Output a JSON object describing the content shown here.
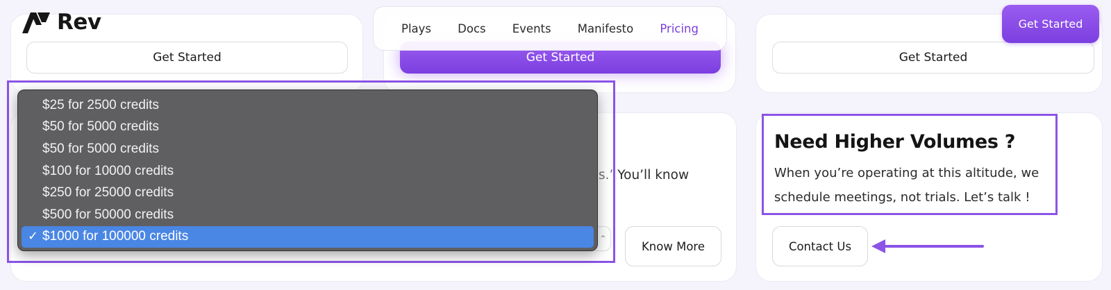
{
  "header": {
    "brand": "Rev",
    "nav": [
      {
        "label": "Plays"
      },
      {
        "label": "Docs"
      },
      {
        "label": "Events"
      },
      {
        "label": "Manifesto"
      },
      {
        "label": "Pricing"
      }
    ],
    "active_nav": "Pricing",
    "cta_label": "Get Started"
  },
  "plans": {
    "buttons": [
      "Get Started",
      "Get Started",
      "Get Started"
    ]
  },
  "credits_dropdown": {
    "options": [
      "$25 for 2500 credits",
      "$50 for 5000 credits",
      "$50 for 5000 credits",
      "$100 for 10000 credits",
      "$250 for 25000 credits",
      "$500 for 50000 credits",
      "$1000 for 100000 credits"
    ],
    "selected_index": 6,
    "check_mark": "✓"
  },
  "middle_card": {
    "partial_text": "s.’ You’ll know",
    "know_more_label": "Know More"
  },
  "enterprise": {
    "title": "Need Higher Volumes ?",
    "body_line1": "When you’re operating at this altitude, we",
    "body_line2": "schedule meetings, not trials. Let’s talk !",
    "contact_label": "Contact Us"
  },
  "colors": {
    "accent": "#8b53e6",
    "selected_option": "#4a86e4",
    "menu_bg": "#58585c"
  }
}
